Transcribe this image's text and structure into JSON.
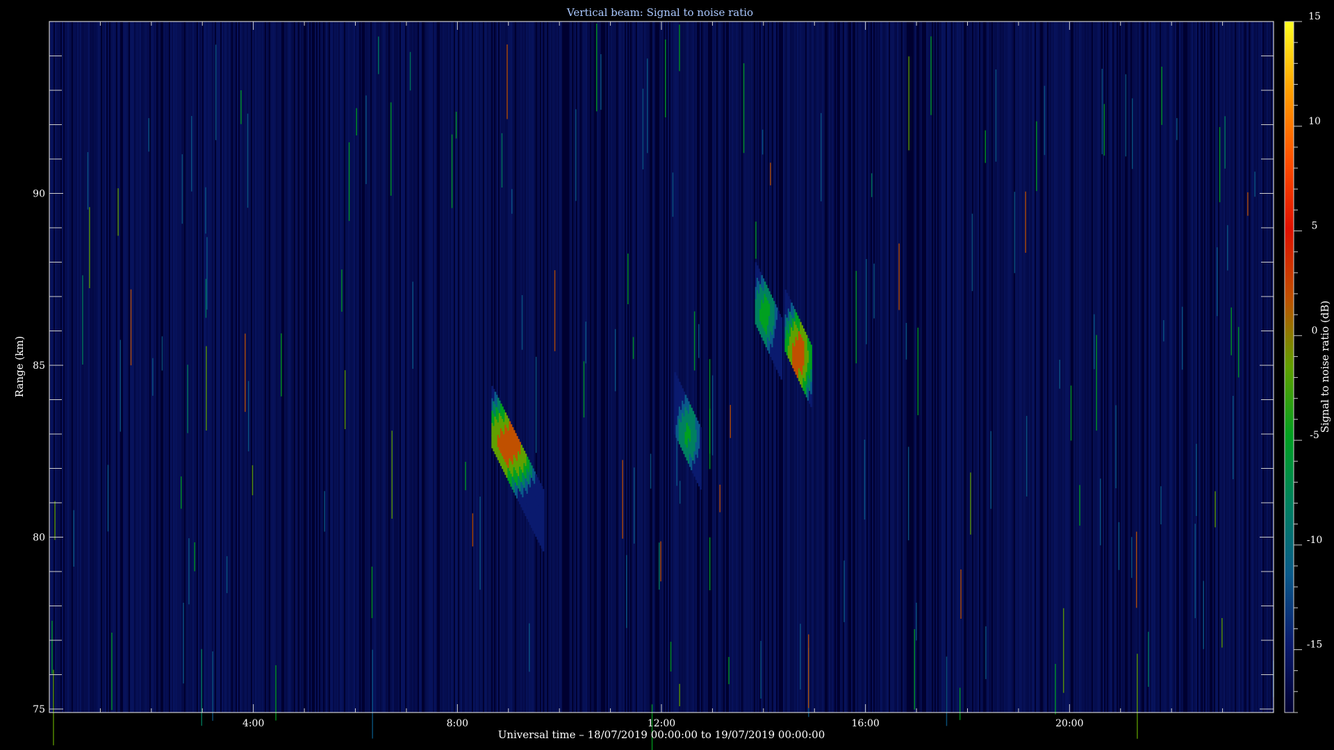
{
  "chart_data": {
    "type": "heatmap",
    "title": "Vertical beam: Signal to noise ratio",
    "xlabel": "Universal time – 18/07/2019 00:00:00 to 19/07/2019 00:00:00",
    "ylabel": "Range (km)",
    "colorbar_label": "Signal to noise ratio (dB)",
    "xlim": [
      "00:00",
      "24:00"
    ],
    "x_tick_labels": [
      "4:00",
      "8:00",
      "12:00",
      "16:00",
      "20:00"
    ],
    "x_ticks_hours": [
      4,
      8,
      12,
      16,
      20
    ],
    "ylim": [
      74.9,
      95
    ],
    "y_ticks": [
      75,
      80,
      85,
      90
    ],
    "colorbar_range": [
      -18,
      15
    ],
    "colorbar_ticks": [
      15,
      10,
      5,
      0,
      -5,
      -10,
      -15
    ],
    "background_snr_db": -17,
    "colormap": [
      "#000030",
      "#0a1a6e",
      "#0a5a8a",
      "#008060",
      "#00a020",
      "#60a000",
      "#c05000",
      "#e01000",
      "#ff5000",
      "#ffa000",
      "#ffff20"
    ],
    "echo_regions": [
      {
        "start": "08:40",
        "end": "09:40",
        "range_top_km": 84.4,
        "range_bottom_km": 79.6,
        "peak_snr_db": 2,
        "peak_time": "09:00",
        "peak_range_km": 82.7
      },
      {
        "start": "12:15",
        "end": "12:45",
        "range_top_km": 84.8,
        "range_bottom_km": 81.4,
        "peak_snr_db": -6,
        "peak_time": "12:30",
        "peak_range_km": 83.0
      },
      {
        "start": "13:50",
        "end": "14:20",
        "range_top_km": 88.0,
        "range_bottom_km": 84.6,
        "peak_snr_db": -5,
        "peak_time": "14:00",
        "peak_range_km": 86.5
      },
      {
        "start": "14:25",
        "end": "14:55",
        "range_top_km": 87.2,
        "range_bottom_km": 83.8,
        "peak_snr_db": 2,
        "peak_time": "14:40",
        "peak_range_km": 85.3
      }
    ]
  }
}
